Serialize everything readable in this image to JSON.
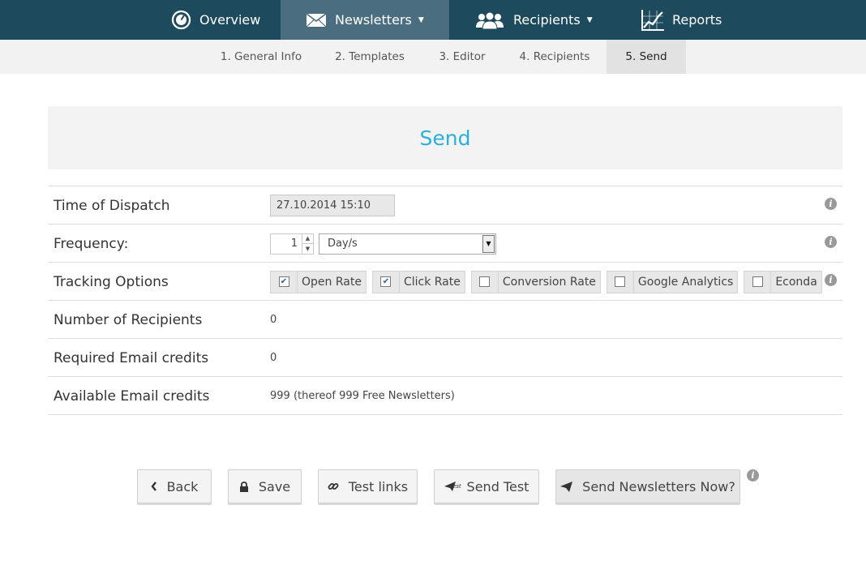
{
  "nav": {
    "items": [
      {
        "label": "Overview",
        "icon": "gauge-icon"
      },
      {
        "label": "Newsletters",
        "icon": "envelope-icon",
        "active": true,
        "dropdown": true
      },
      {
        "label": "Recipients",
        "icon": "users-icon",
        "dropdown": true
      },
      {
        "label": "Reports",
        "icon": "chart-icon"
      }
    ]
  },
  "steps": [
    {
      "label": "1. General Info"
    },
    {
      "label": "2. Templates"
    },
    {
      "label": "3. Editor"
    },
    {
      "label": "4. Recipients"
    },
    {
      "label": "5. Send",
      "active": true
    }
  ],
  "section": {
    "title": "Send"
  },
  "form": {
    "dispatch": {
      "label": "Time of Dispatch",
      "value": "27.10.2014 15:10"
    },
    "frequency": {
      "label": "Frequency:",
      "count": "1",
      "unit": "Day/s"
    },
    "tracking": {
      "label": "Tracking Options",
      "options": [
        {
          "label": "Open Rate",
          "checked": true
        },
        {
          "label": "Click Rate",
          "checked": true
        },
        {
          "label": "Conversion Rate",
          "checked": false
        },
        {
          "label": "Google Analytics",
          "checked": false
        },
        {
          "label": "Econda",
          "checked": false
        }
      ]
    },
    "recipients": {
      "label": "Number of Recipients",
      "value": "0"
    },
    "required": {
      "label": "Required Email credits",
      "value": "0"
    },
    "available": {
      "label": "Available Email credits",
      "value": "999 (thereof 999 Free Newsletters)"
    }
  },
  "buttons": {
    "back": "Back",
    "save": "Save",
    "test_links": "Test links",
    "send_test": "Send Test",
    "send_now": "Send Newsletters Now?",
    "send_test_icon_text": "Test"
  },
  "colors": {
    "nav_bg": "#1e4a5e",
    "nav_active": "#4a6e80",
    "accent": "#2ab0d8"
  }
}
